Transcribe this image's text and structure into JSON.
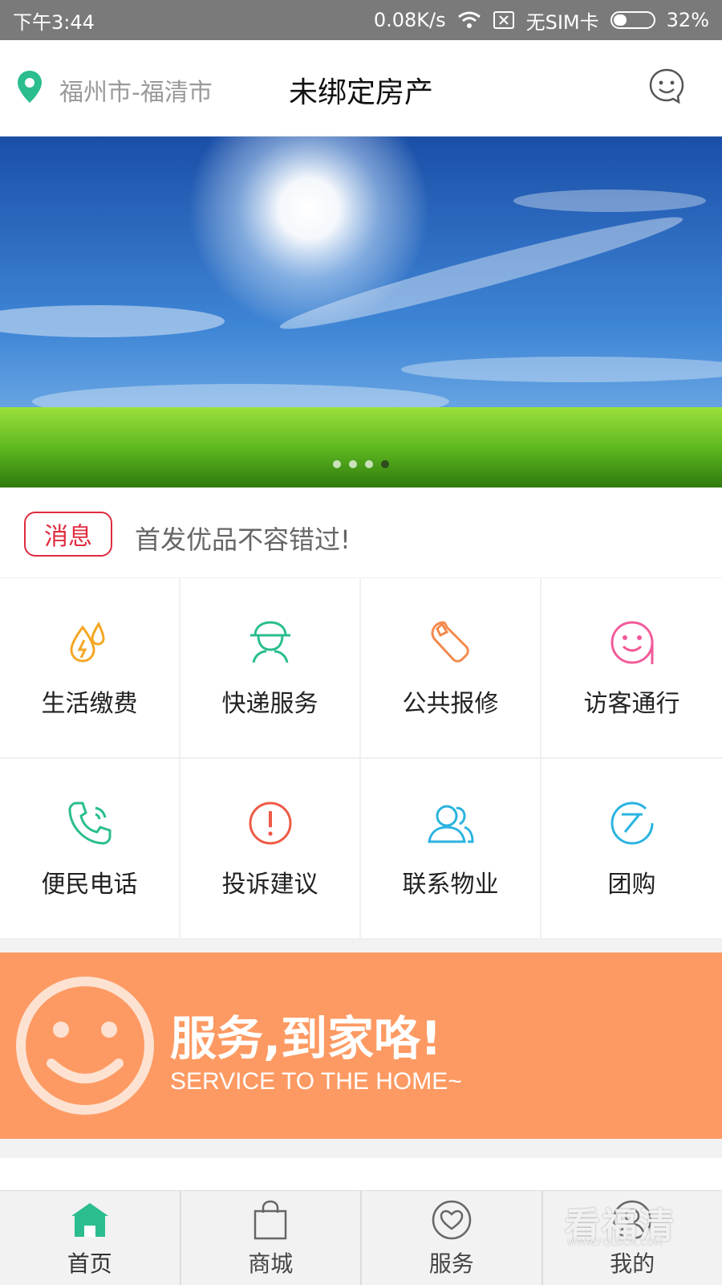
{
  "status_bar": {
    "time": "下午3:44",
    "speed": "0.08K/s",
    "sim": "无SIM卡",
    "battery": "32%"
  },
  "header": {
    "location": "福州市-福清市",
    "title": "未绑定房产"
  },
  "notice": {
    "tag": "消息",
    "text": "首发优品不容错过!"
  },
  "services": [
    {
      "label": "生活缴费",
      "icon": "utility-payment-icon",
      "color": "#f5a623"
    },
    {
      "label": "快递服务",
      "icon": "courier-icon",
      "color": "#2bbd8f"
    },
    {
      "label": "公共报修",
      "icon": "wrench-icon",
      "color": "#f3894c"
    },
    {
      "label": "访客通行",
      "icon": "smiley-icon",
      "color": "#f25a9a"
    },
    {
      "label": "便民电话",
      "icon": "phone-icon",
      "color": "#2bbd8f"
    },
    {
      "label": "投诉建议",
      "icon": "alert-icon",
      "color": "#ee5a46"
    },
    {
      "label": "联系物业",
      "icon": "contacts-icon",
      "color": "#2ab3e0"
    },
    {
      "label": "团购",
      "icon": "group-buy-icon",
      "color": "#2ab3e0"
    }
  ],
  "promo": {
    "title": "服务,到家咯!",
    "subtitle": "SERVICE TO THE HOME~"
  },
  "tabs": [
    {
      "label": "首页",
      "icon": "home-icon",
      "active": true
    },
    {
      "label": "商城",
      "icon": "shopping-bag-icon",
      "active": false
    },
    {
      "label": "服务",
      "icon": "service-heart-icon",
      "active": false
    },
    {
      "label": "我的",
      "icon": "profile-icon",
      "active": false
    }
  ],
  "watermark": {
    "text": "看福清",
    "url": "WWW.FQLOOK.COM"
  },
  "colors": {
    "accent_green": "#2bbd8f",
    "promo_orange": "#fd9a63",
    "notice_red": "#e02b3f"
  }
}
